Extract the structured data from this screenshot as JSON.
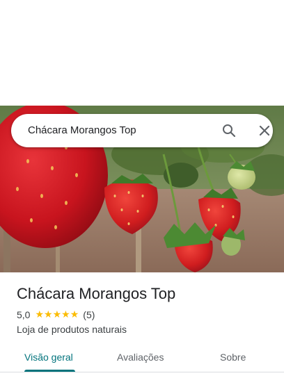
{
  "search": {
    "query": "Chácara Morangos Top",
    "search_icon": "search-icon",
    "close_icon": "close-icon"
  },
  "hero": {
    "image": "strawberry-plants-photo"
  },
  "place": {
    "name": "Chácara Morangos Top",
    "rating": "5,0",
    "stars": [
      "★",
      "★",
      "★",
      "★",
      "★"
    ],
    "reviews": "(5)",
    "category": "Loja de produtos naturais"
  },
  "tabs": [
    {
      "label": "Visão geral",
      "active": true
    },
    {
      "label": "Avaliações",
      "active": false
    },
    {
      "label": "Sobre",
      "active": false
    }
  ],
  "colors": {
    "accent": "#01737c",
    "star": "#fbbc04",
    "text_primary": "#202124",
    "text_secondary": "#3c4043"
  }
}
